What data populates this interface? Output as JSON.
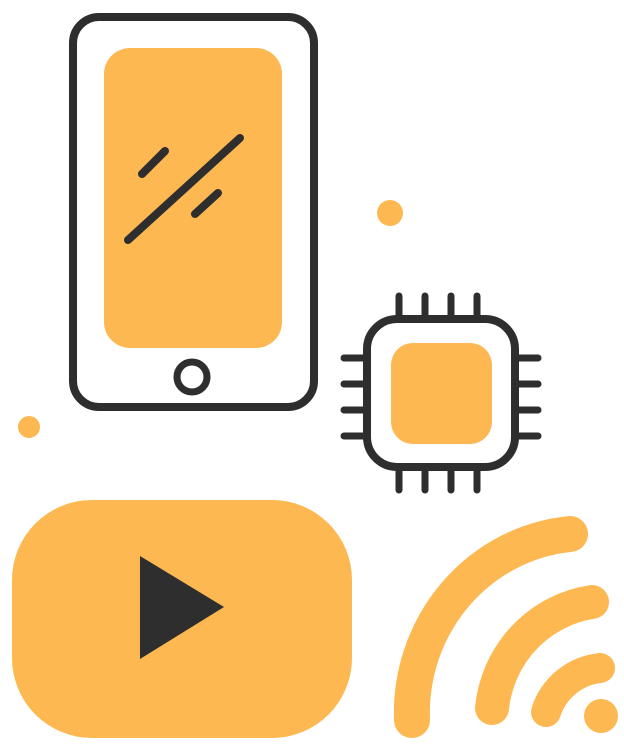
{
  "colors": {
    "accent": "#FDB851",
    "outline": "#2E2E2E",
    "background": "#FFFFFF"
  },
  "icons": [
    "smartphone-icon",
    "microchip-icon",
    "video-play-icon",
    "wifi-signal-icon"
  ]
}
